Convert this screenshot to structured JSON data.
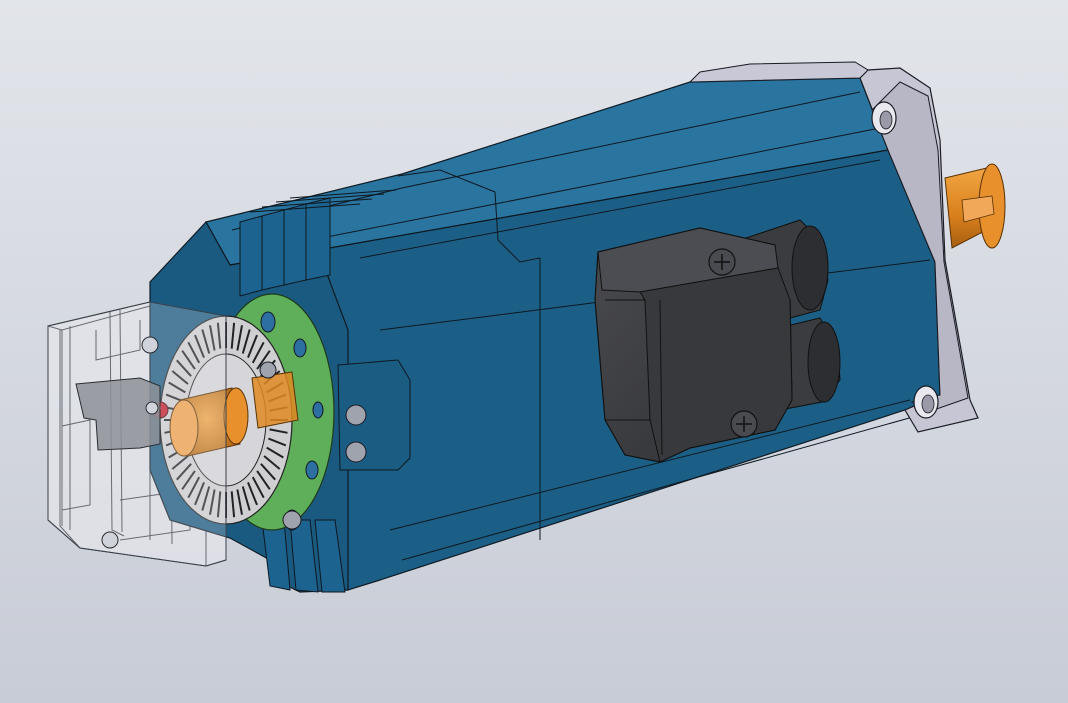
{
  "scene": {
    "background_top": "#e2e5ea",
    "background_bottom": "#c8ccd6",
    "housing_color": "#1c5f86",
    "housing_dark": "#134868",
    "housing_light": "#2a78a5",
    "flange_color": "#c4c3d1",
    "shaft_color": "#e08a22",
    "connector_color": "#3f4043",
    "encoder_pcb_color": "#5fae5a",
    "encoder_disc_color": "#cfcfd2",
    "cover_color": "#dfe2e8",
    "edge_color": "#101a22"
  }
}
